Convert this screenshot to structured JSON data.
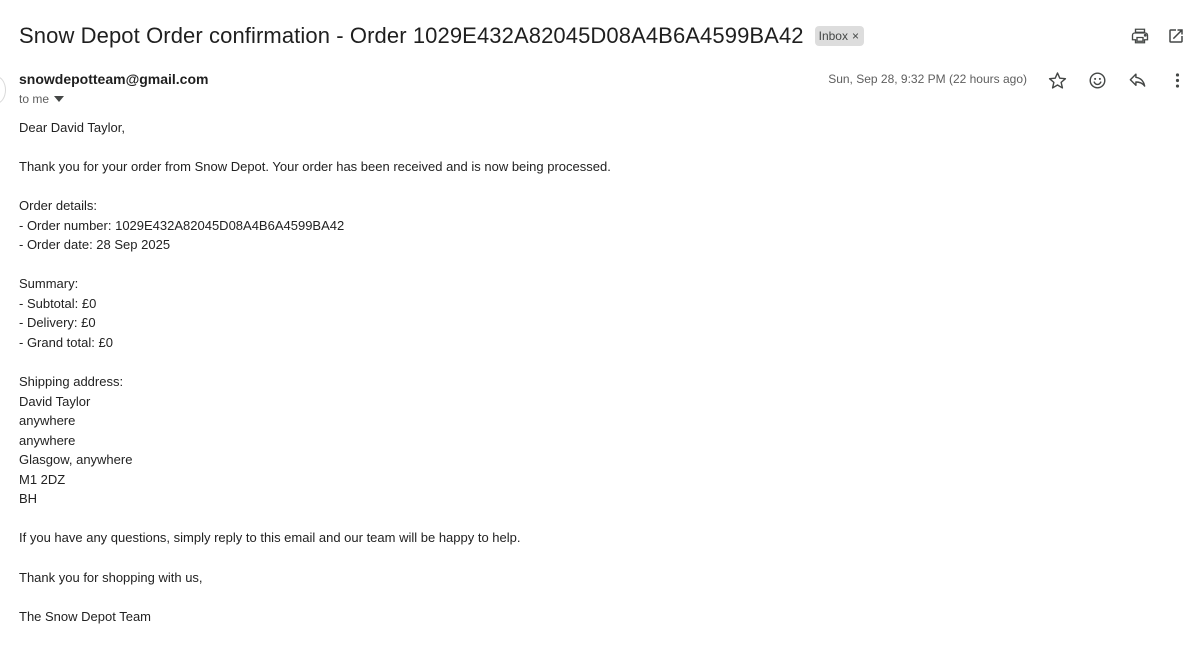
{
  "email": {
    "subject": "Snow Depot Order confirmation - Order 1029E432A82045D08A4B6A4599BA42",
    "label": "Inbox",
    "label_remove": "×",
    "sender": "snowdepotteam@gmail.com",
    "recipient": "to me",
    "date": "Sun, Sep 28, 9:32 PM (22 hours ago)"
  },
  "body": {
    "greeting": "Dear David Taylor,",
    "intro": "Thank you for your order from Snow Depot. Your order has been received and is now being processed.",
    "order_heading": "Order details:",
    "order_number": "- Order number: 1029E432A82045D08A4B6A4599BA42",
    "order_date": "- Order date: 28 Sep 2025",
    "summary_heading": "Summary:",
    "subtotal": "- Subtotal: £0",
    "delivery": "- Delivery: £0",
    "grand_total": "- Grand total: £0",
    "shipping_heading": "Shipping address:",
    "address": [
      "David Taylor",
      "anywhere",
      "anywhere",
      "Glasgow, anywhere",
      "M1 2DZ",
      "BH"
    ],
    "questions": "If you have any questions, simply reply to this email and our team will be happy to help.",
    "thanks": "Thank you for shopping with us,",
    "signature": "The Snow Depot Team"
  },
  "icons": {
    "print": "print-icon",
    "open_new_window": "open-in-new-window-icon",
    "star": "star-icon",
    "emoji": "emoji-icon",
    "reply": "reply-icon",
    "more": "more-vertical-icon",
    "dropdown": "caret-down-icon"
  }
}
